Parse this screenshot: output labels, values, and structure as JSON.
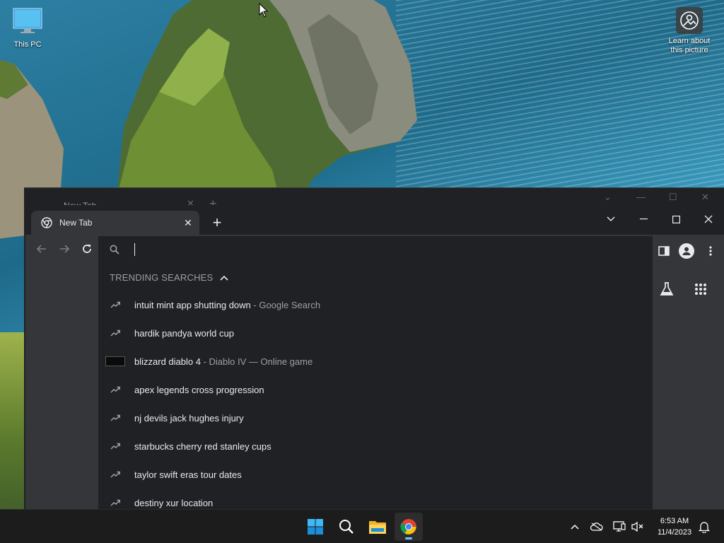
{
  "desktop": {
    "icons": [
      {
        "label": "This PC"
      },
      {
        "label": "Learn about this picture"
      }
    ]
  },
  "background_window": {
    "tab_title": "New Tab"
  },
  "browser": {
    "tab": {
      "title": "New Tab"
    },
    "omnibox": {
      "value": "",
      "placeholder": ""
    },
    "section_header": "TRENDING SEARCHES",
    "suggestions": [
      {
        "text": "intuit mint app shutting down",
        "sub": " - Google Search",
        "icon": "trending-icon"
      },
      {
        "text": "hardik pandya world cup",
        "sub": "",
        "icon": "trending-icon"
      },
      {
        "text": "blizzard diablo 4",
        "sub": " - Diablo IV — Online game",
        "icon": "game-thumbnail"
      },
      {
        "text": "apex legends cross progression",
        "sub": "",
        "icon": "trending-icon"
      },
      {
        "text": "nj devils jack hughes injury",
        "sub": "",
        "icon": "trending-icon"
      },
      {
        "text": "starbucks cherry red stanley cups",
        "sub": "",
        "icon": "trending-icon"
      },
      {
        "text": "taylor swift eras tour dates",
        "sub": "",
        "icon": "trending-icon"
      },
      {
        "text": "destiny xur location",
        "sub": "",
        "icon": "trending-icon"
      }
    ]
  },
  "taskbar": {
    "apps": [
      "start-icon",
      "search-icon",
      "file-explorer-icon",
      "chrome-icon"
    ],
    "active_app": "chrome-icon",
    "clock": {
      "time": "6:53 AM",
      "date": "11/4/2023"
    }
  },
  "colors": {
    "chrome_dark": "#202124",
    "chrome_toolbar": "#35363a",
    "text_primary": "#e8eaed",
    "text_secondary": "#9aa0a6",
    "taskbar": "#1c1c1c",
    "accent": "#60cdff"
  }
}
